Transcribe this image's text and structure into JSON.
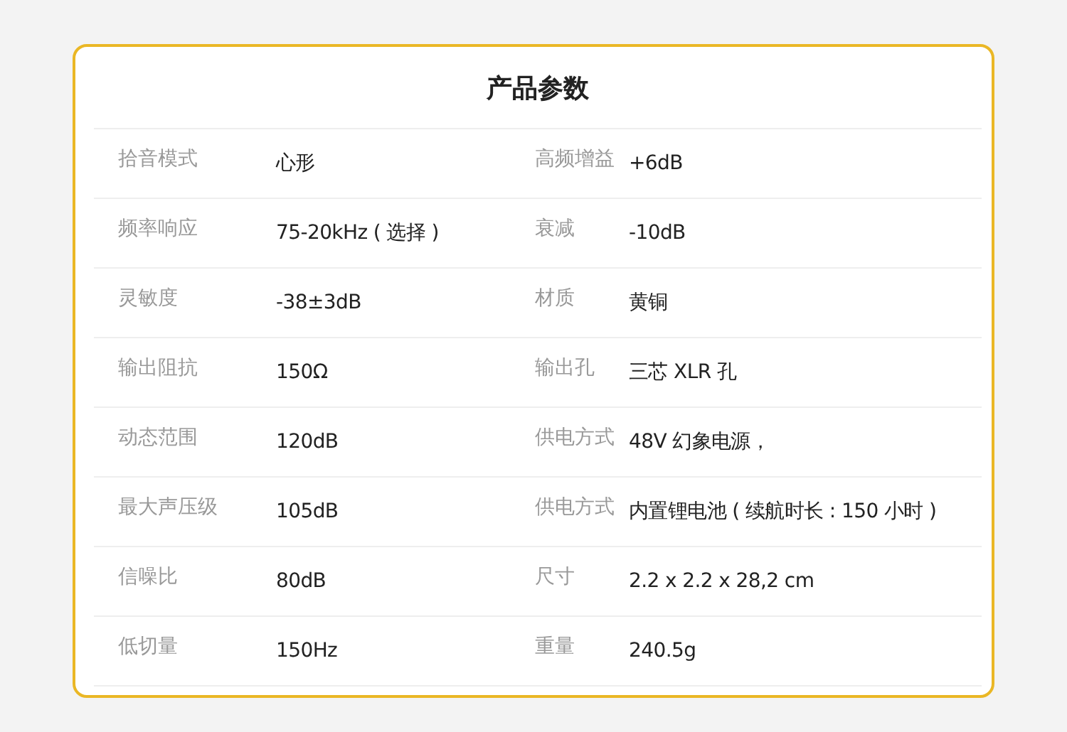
{
  "title": "产品参数",
  "rows": [
    {
      "label_1": "拾音模式",
      "value_1": "心形",
      "label_2": "高频增益",
      "value_2": "+6dB"
    },
    {
      "label_1": "频率响应",
      "value_1": "75-20kHz ( 选择 )",
      "label_2": "衰减",
      "value_2": "-10dB"
    },
    {
      "label_1": "灵敏度",
      "value_1": "-38±3dB",
      "label_2": "材质",
      "value_2": "黄铜"
    },
    {
      "label_1": "输出阻抗",
      "value_1": "150Ω",
      "label_2": "输出孔",
      "value_2": "三芯 XLR 孔"
    },
    {
      "label_1": "动态范围",
      "value_1": "120dB",
      "label_2": "供电方式",
      "value_2": "48V 幻象电源，"
    },
    {
      "label_1": "最大声压级",
      "value_1": "105dB",
      "label_2": "供电方式",
      "value_2": "内置锂电池 ( 续航时长 : 150 小时 )"
    },
    {
      "label_1": "信噪比",
      "value_1": "80dB",
      "label_2": "尺寸",
      "value_2": "2.2 x 2.2 x 28,2 cm"
    },
    {
      "label_1": "低切量",
      "value_1": "150Hz",
      "label_2": "重量",
      "value_2": "240.5g"
    }
  ]
}
